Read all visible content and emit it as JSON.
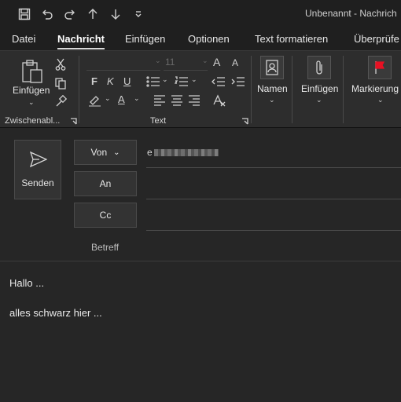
{
  "window": {
    "title": "Unbenannt - Nachrich"
  },
  "menu": {
    "tabs": [
      "Datei",
      "Nachricht",
      "Einfügen",
      "Optionen",
      "Text formatieren",
      "Überprüfe"
    ]
  },
  "ribbon": {
    "clipboard": {
      "paste_label": "Einfügen",
      "group_label": "Zwischenabl..."
    },
    "text": {
      "font_size": "11",
      "group_label": "Text",
      "bold": "F",
      "italic": "K",
      "underline": "U",
      "font_color": "A",
      "grow": "A",
      "shrink": "A"
    },
    "names": {
      "label": "Namen"
    },
    "insert": {
      "label": "Einfügen"
    },
    "tags": {
      "label": "Markierung"
    },
    "accent_color": "#e81123"
  },
  "compose": {
    "send_label": "Senden",
    "from_label": "Von",
    "from_value": "e",
    "to_label": "An",
    "cc_label": "Cc",
    "subject_label": "Betreff"
  },
  "body": {
    "lines": [
      "Hallo ...",
      "alles schwarz hier ..."
    ]
  }
}
